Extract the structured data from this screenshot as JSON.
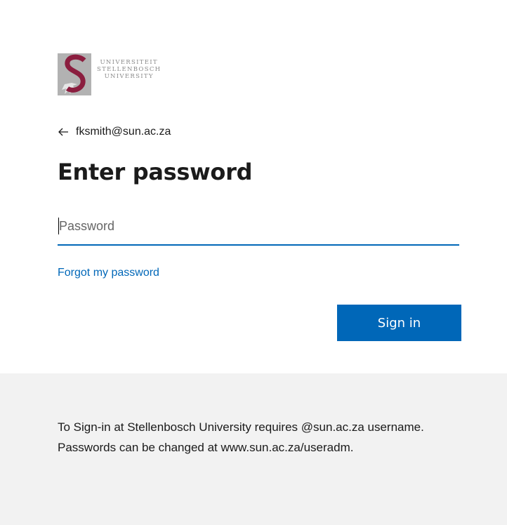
{
  "logo": {
    "line1": "UNIVERSITEIT",
    "line2": "STELLENBOSCH",
    "line3": "UNIVERSITY",
    "mark_color": "#8b1e3f",
    "mark_bg_color": "#9a9a9a"
  },
  "identity": {
    "back_icon": "back-arrow-icon",
    "email": "fksmith@sun.ac.za"
  },
  "heading": "Enter password",
  "password": {
    "placeholder": "Password",
    "value": ""
  },
  "forgot_link": "Forgot my password",
  "signin_button": "Sign in",
  "footer": {
    "message": "To Sign-in at Stellenbosch University requires @sun.ac.za username. Passwords can be changed at www.sun.ac.za/useradm."
  },
  "colors": {
    "accent": "#0067b8",
    "footer_bg": "#f2f2f2"
  }
}
